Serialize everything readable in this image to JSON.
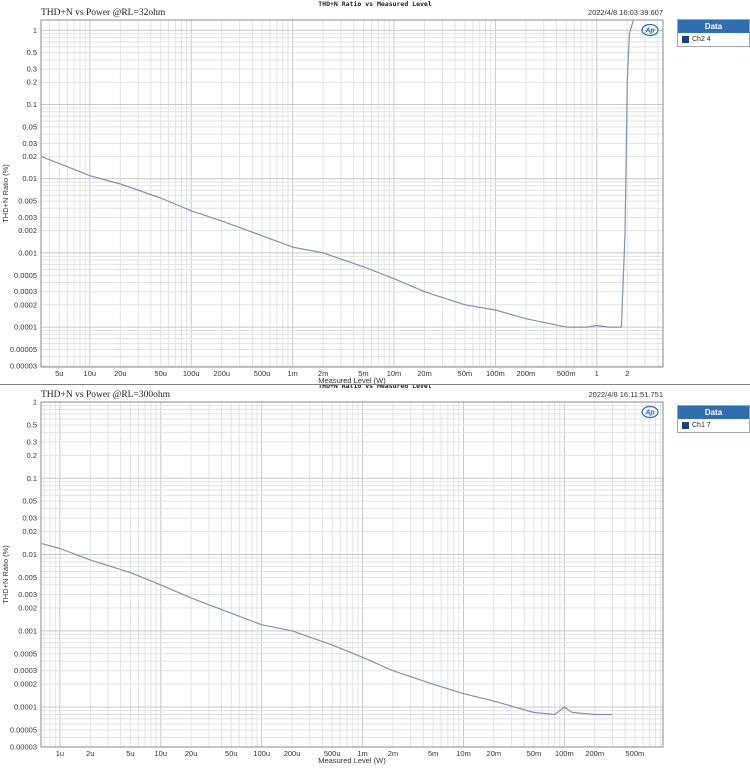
{
  "chart_data": [
    {
      "type": "line",
      "title": "THD+N Ratio vs Measured Level",
      "subtitle": "THD+N  vs Power @RL=32ohm",
      "timestamp": "2022/4/8 16:03:39.607",
      "xlabel": "Measured Level (W)",
      "ylabel": "THD+N Ratio (%)",
      "x_scale": "log",
      "y_scale": "log",
      "xlim": [
        3.3e-06,
        4.5
      ],
      "ylim": [
        2.9e-05,
        1.38
      ],
      "xtick_values": [
        5e-06,
        1e-05,
        2e-05,
        5e-05,
        0.0001,
        0.0002,
        0.0005,
        0.001,
        0.002,
        0.005,
        0.01,
        0.02,
        0.05,
        0.1,
        0.2,
        0.5,
        1,
        2
      ],
      "xtick_labels": [
        "5u",
        "10u",
        "20u",
        "50u",
        "100u",
        "200u",
        "500u",
        "1m",
        "2m",
        "5m",
        "10m",
        "20m",
        "50m",
        "100m",
        "200m",
        "500m",
        "1",
        "2"
      ],
      "ytick_values": [
        1,
        0.5,
        0.3,
        0.2,
        0.1,
        0.05,
        0.03,
        0.02,
        0.01,
        0.005,
        0.003,
        0.002,
        0.001,
        0.0005,
        0.0003,
        0.0002,
        0.0001,
        5e-05,
        3e-05
      ],
      "ytick_labels": [
        "1",
        "0.5",
        "0.3",
        "0.2",
        "0.1",
        "0.05",
        "0.03",
        "0.02",
        "0.01",
        "0.005",
        "0.003",
        "0.002",
        "0.001",
        "0.0005",
        "0.0003",
        "0.0002",
        "0.0001",
        "0.00005",
        "0.00003"
      ],
      "grid": true,
      "legend_title": "Data",
      "series_color": "#7f93b0",
      "legend_swatch_color": "#1f3f86",
      "series": [
        {
          "name": "Ch2  4",
          "x": [
            3.3e-06,
            5e-06,
            1e-05,
            2e-05,
            5e-05,
            0.0001,
            0.0002,
            0.0005,
            0.001,
            0.002,
            0.005,
            0.01,
            0.02,
            0.05,
            0.1,
            0.2,
            0.5,
            0.8,
            1,
            1.3,
            1.75,
            1.9,
            2.0,
            2.1,
            2.3
          ],
          "y": [
            0.02,
            0.016,
            0.011,
            0.0085,
            0.0055,
            0.0037,
            0.0027,
            0.0017,
            0.0012,
            0.001,
            0.00065,
            0.00045,
            0.0003,
            0.0002,
            0.00017,
            0.00013,
            0.0001,
            0.0001,
            0.000105,
            0.0001,
            0.0001,
            0.0018,
            0.2,
            0.9,
            1.38
          ]
        }
      ]
    },
    {
      "type": "line",
      "title": "THD+N Ratio vs Measured Level",
      "subtitle": "THD+N  vs Power @RL=300ohm",
      "timestamp": "2022/4/8 16:11:51.751",
      "xlabel": "Measured Level (W)",
      "ylabel": "THD+N Ratio (%)",
      "x_scale": "log",
      "y_scale": "log",
      "xlim": [
        6.5e-07,
        0.95
      ],
      "ylim": [
        3e-05,
        1
      ],
      "xtick_values": [
        1e-06,
        2e-06,
        5e-06,
        1e-05,
        2e-05,
        5e-05,
        0.0001,
        0.0002,
        0.0005,
        0.001,
        0.002,
        0.005,
        0.01,
        0.02,
        0.05,
        0.1,
        0.2,
        0.5
      ],
      "xtick_labels": [
        "1u",
        "2u",
        "5u",
        "10u",
        "20u",
        "50u",
        "100u",
        "200u",
        "500u",
        "1m",
        "2m",
        "5m",
        "10m",
        "20m",
        "50m",
        "100m",
        "200m",
        "500m"
      ],
      "ytick_values": [
        1,
        0.5,
        0.3,
        0.2,
        0.1,
        0.05,
        0.03,
        0.02,
        0.01,
        0.005,
        0.003,
        0.002,
        0.001,
        0.0005,
        0.0003,
        0.0002,
        0.0001,
        5e-05,
        3e-05
      ],
      "ytick_labels": [
        "1",
        "0.5",
        "0.3",
        "0.2",
        "0.1",
        "0.05",
        "0.03",
        "0.02",
        "0.01",
        "0.005",
        "0.003",
        "0.002",
        "0.001",
        "0.0005",
        "0.0003",
        "0.0002",
        "0.0001",
        "0.00005",
        "0.00003"
      ],
      "grid": true,
      "legend_title": "Data",
      "series_color": "#7f93b0",
      "legend_swatch_color": "#1f3f86",
      "series": [
        {
          "name": "Ch1  7",
          "x": [
            6.5e-07,
            1e-06,
            2e-06,
            5e-06,
            1e-05,
            2e-05,
            5e-05,
            0.0001,
            0.0002,
            0.0005,
            0.001,
            0.002,
            0.005,
            0.01,
            0.02,
            0.05,
            0.08,
            0.1,
            0.12,
            0.2,
            0.3
          ],
          "y": [
            0.014,
            0.012,
            0.0085,
            0.0058,
            0.004,
            0.0027,
            0.0017,
            0.0012,
            0.001,
            0.00065,
            0.00045,
            0.0003,
            0.0002,
            0.00015,
            0.00012,
            8.5e-05,
            8e-05,
            0.0001,
            8.5e-05,
            8e-05,
            8e-05
          ]
        }
      ]
    }
  ]
}
